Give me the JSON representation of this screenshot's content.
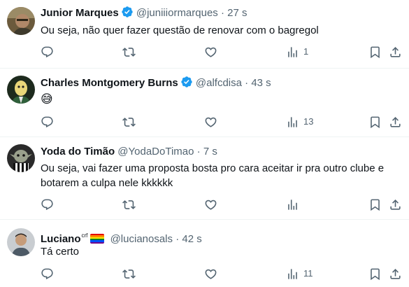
{
  "tweets": [
    {
      "name": "Junior Marques",
      "verified": true,
      "handle": "@juniiiormarques",
      "separator": "·",
      "time": "27 s",
      "text": "Ou seja, não quer fazer questão de renovar com o bagregol",
      "views": "1"
    },
    {
      "name": "Charles Montgomery Burns",
      "verified": true,
      "handle": "@alfcdisa",
      "separator": "·",
      "time": "43 s",
      "emoji": "😅",
      "views": "13"
    },
    {
      "name": "Yoda do Timão",
      "handle": "@YodaDoTimao",
      "separator": "·",
      "time": "7 s",
      "text_line1": "Ou seja, vai fazer uma proposta bosta pro cara aceitar ir pra outro clube e",
      "text_line2": "botarem a culpa nele kkkkkk",
      "views": ""
    },
    {
      "name": "Luciano",
      "name_suffix": "crf",
      "handle": "@lucianosals",
      "separator": "·",
      "time": "42 s",
      "text": "Tá certo",
      "views": "11"
    }
  ],
  "icons": [
    "reply-icon",
    "retweet-icon",
    "like-icon",
    "views-icon",
    "bookmark-icon",
    "share-icon"
  ],
  "colors": {
    "verified": "#1d9bf0",
    "secondary_text": "#536471",
    "divider": "#eff3f4"
  }
}
